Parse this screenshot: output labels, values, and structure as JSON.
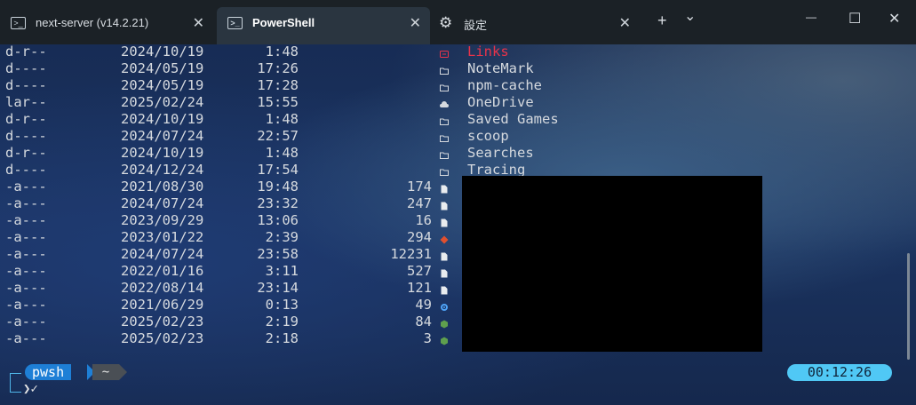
{
  "tabs": [
    {
      "label": "next-server (v14.2.21)",
      "icon": "powershell-icon"
    },
    {
      "label": "PowerShell",
      "icon": "powershell-icon",
      "active": true
    },
    {
      "label": "設定",
      "icon": "gear-icon"
    }
  ],
  "tab_actions": {
    "new_tab": "+",
    "dropdown": "⌄"
  },
  "window": {
    "minimize": "—",
    "maximize": "☐",
    "close": "✕"
  },
  "rows": [
    {
      "mode": "d-r--",
      "date": "2024/10/19",
      "time": "1:48",
      "size": "",
      "icon": "link-icon",
      "name": "Links",
      "highlight": true
    },
    {
      "mode": "d----",
      "date": "2024/05/19",
      "time": "17:26",
      "size": "",
      "icon": "folder-icon",
      "name": "NoteMark"
    },
    {
      "mode": "d----",
      "date": "2024/05/19",
      "time": "17:28",
      "size": "",
      "icon": "folder-icon",
      "name": "npm-cache"
    },
    {
      "mode": "lar--",
      "date": "2025/02/24",
      "time": "15:55",
      "size": "",
      "icon": "cloud-icon",
      "name": "OneDrive"
    },
    {
      "mode": "d-r--",
      "date": "2024/10/19",
      "time": "1:48",
      "size": "",
      "icon": "folder-icon",
      "name": "Saved Games"
    },
    {
      "mode": "d----",
      "date": "2024/07/24",
      "time": "22:57",
      "size": "",
      "icon": "folder-icon",
      "name": "scoop"
    },
    {
      "mode": "d-r--",
      "date": "2024/10/19",
      "time": "1:48",
      "size": "",
      "icon": "folder-icon",
      "name": "Searches"
    },
    {
      "mode": "d----",
      "date": "2024/12/24",
      "time": "17:54",
      "size": "",
      "icon": "folder-icon",
      "name": "Tracing"
    },
    {
      "mode": "-a---",
      "date": "2021/08/30",
      "time": "19:48",
      "size": "174",
      "icon": "file-icon",
      "name": ""
    },
    {
      "mode": "-a---",
      "date": "2024/07/24",
      "time": "23:32",
      "size": "247",
      "icon": "file-icon",
      "name": ""
    },
    {
      "mode": "-a---",
      "date": "2023/09/29",
      "time": "13:06",
      "size": "16",
      "icon": "file-icon",
      "name": ""
    },
    {
      "mode": "-a---",
      "date": "2023/01/22",
      "time": "2:39",
      "size": "294",
      "icon": "git-icon",
      "name": ""
    },
    {
      "mode": "-a---",
      "date": "2024/07/24",
      "time": "23:58",
      "size": "12231",
      "icon": "file-icon",
      "name": ""
    },
    {
      "mode": "-a---",
      "date": "2022/01/16",
      "time": "3:11",
      "size": "527",
      "icon": "file-icon",
      "name": ""
    },
    {
      "mode": "-a---",
      "date": "2022/08/14",
      "time": "23:14",
      "size": "121",
      "icon": "file-icon",
      "name": ""
    },
    {
      "mode": "-a---",
      "date": "2021/06/29",
      "time": "0:13",
      "size": "49",
      "icon": "settings-file-icon",
      "name": ""
    },
    {
      "mode": "-a---",
      "date": "2025/02/23",
      "time": "2:19",
      "size": "84",
      "icon": "node-icon",
      "name": ""
    },
    {
      "mode": "-a---",
      "date": "2025/02/23",
      "time": "2:18",
      "size": "3",
      "icon": "node-icon",
      "name": ""
    }
  ],
  "prompt": {
    "shell": "pwsh",
    "path": "~",
    "time": "00:12:26",
    "caret": "❯✓"
  },
  "colors": {
    "link": "#e8334a",
    "folder": "#d5d9de",
    "git": "#e0502f",
    "gear": "#4fa3f7",
    "node": "#5fa04e",
    "timebar": "#50c8f5",
    "shellbar": "#1e7fd6"
  }
}
